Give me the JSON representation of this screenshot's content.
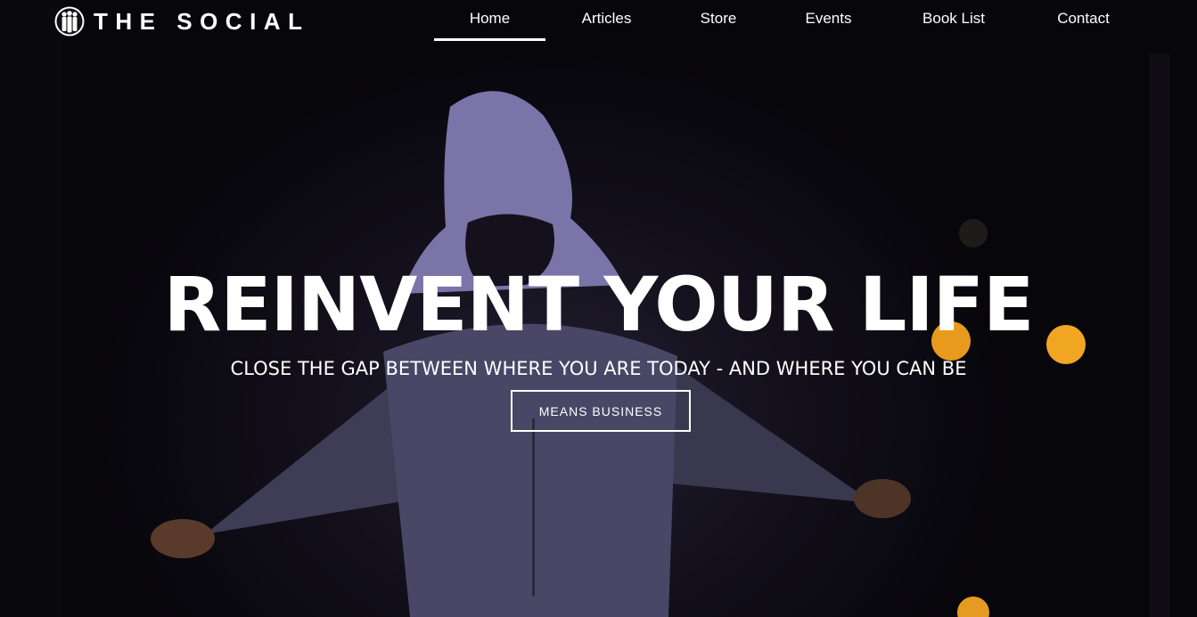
{
  "brand": {
    "logo_text": "THE SOCIAL",
    "logo_icon": "people-silhouette-icon"
  },
  "nav": {
    "items": [
      {
        "label": "Home",
        "active": true
      },
      {
        "label": "Articles",
        "active": false
      },
      {
        "label": "Store",
        "active": false
      },
      {
        "label": "Events",
        "active": false
      },
      {
        "label": "Book List",
        "active": false
      },
      {
        "label": "Contact",
        "active": false
      }
    ]
  },
  "hero": {
    "title": "REINVENT YOUR LIFE",
    "subtitle": "CLOSE THE GAP BETWEEN WHERE YOU ARE TODAY - AND WHERE YOU CAN BE",
    "cta_label": "MEANS BUSINESS",
    "background_image": "hooded-figure-photo"
  },
  "colors": {
    "text": "#ffffff",
    "background": "#0b0a10",
    "accent_light": "#f0a623"
  }
}
